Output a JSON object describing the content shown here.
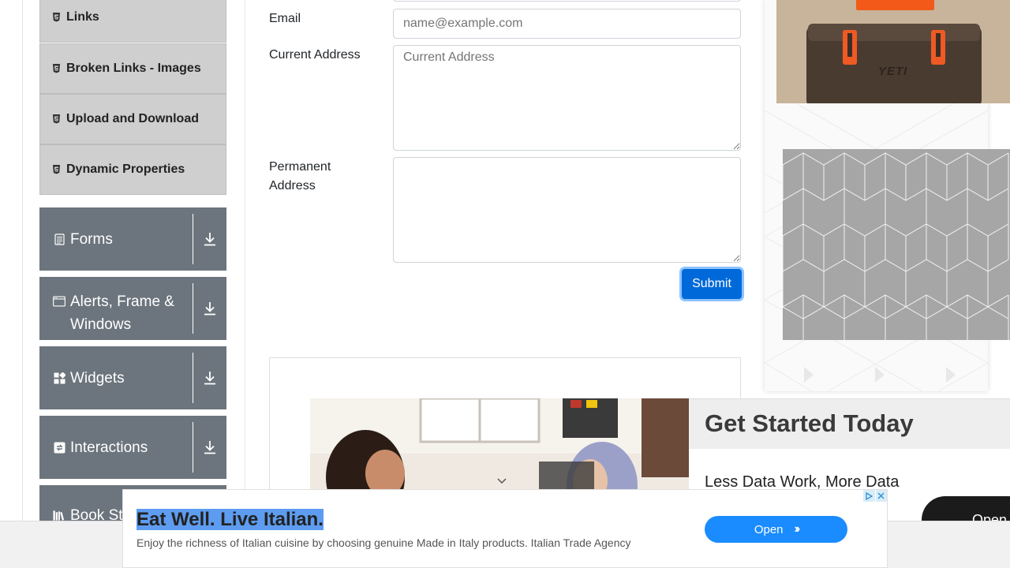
{
  "sidebar": {
    "sub_items": [
      {
        "label": "Links",
        "icon": "html5-icon"
      },
      {
        "label": "Broken Links - Images",
        "icon": "html5-icon"
      },
      {
        "label": "Upload and Download",
        "icon": "html5-icon"
      },
      {
        "label": "Dynamic Properties",
        "icon": "html5-icon"
      }
    ],
    "groups": [
      {
        "label": "Forms",
        "icon": "document-icon"
      },
      {
        "label": "Alerts, Frame & Windows",
        "label_line1": "Alerts, Frame &",
        "label_line2": "Windows",
        "icon": "window-icon"
      },
      {
        "label": "Widgets",
        "icon": "widgets-icon"
      },
      {
        "label": "Interactions",
        "icon": "interactions-icon"
      },
      {
        "label": "Book Store Application",
        "label_visible": "Book St",
        "icon": "books-icon"
      }
    ]
  },
  "form": {
    "email_label": "Email",
    "email_placeholder": "name@example.com",
    "current_address_label": "Current Address",
    "current_address_placeholder": "Current Address",
    "permanent_address_label_line1": "Permanent",
    "permanent_address_label_line2": "Address",
    "submit_label": "Submit"
  },
  "ads": {
    "get_started": {
      "title": "Get Started Today",
      "subtitle": "Less Data Work, More Data",
      "open_label": "Open"
    },
    "banner": {
      "title": "Eat Well. Live Italian.",
      "description": "Enjoy the richness of Italian cuisine by choosing genuine Made in Italy products. Italian Trade Agency",
      "open_label": "Open"
    },
    "cooler": {
      "brand": "YETI"
    }
  },
  "colors": {
    "sidebar_group_bg": "#6c757d",
    "sub_item_bg": "#cfcfcf",
    "submit_bg": "#0069d9",
    "banner_open_bg": "#1a8cff"
  }
}
